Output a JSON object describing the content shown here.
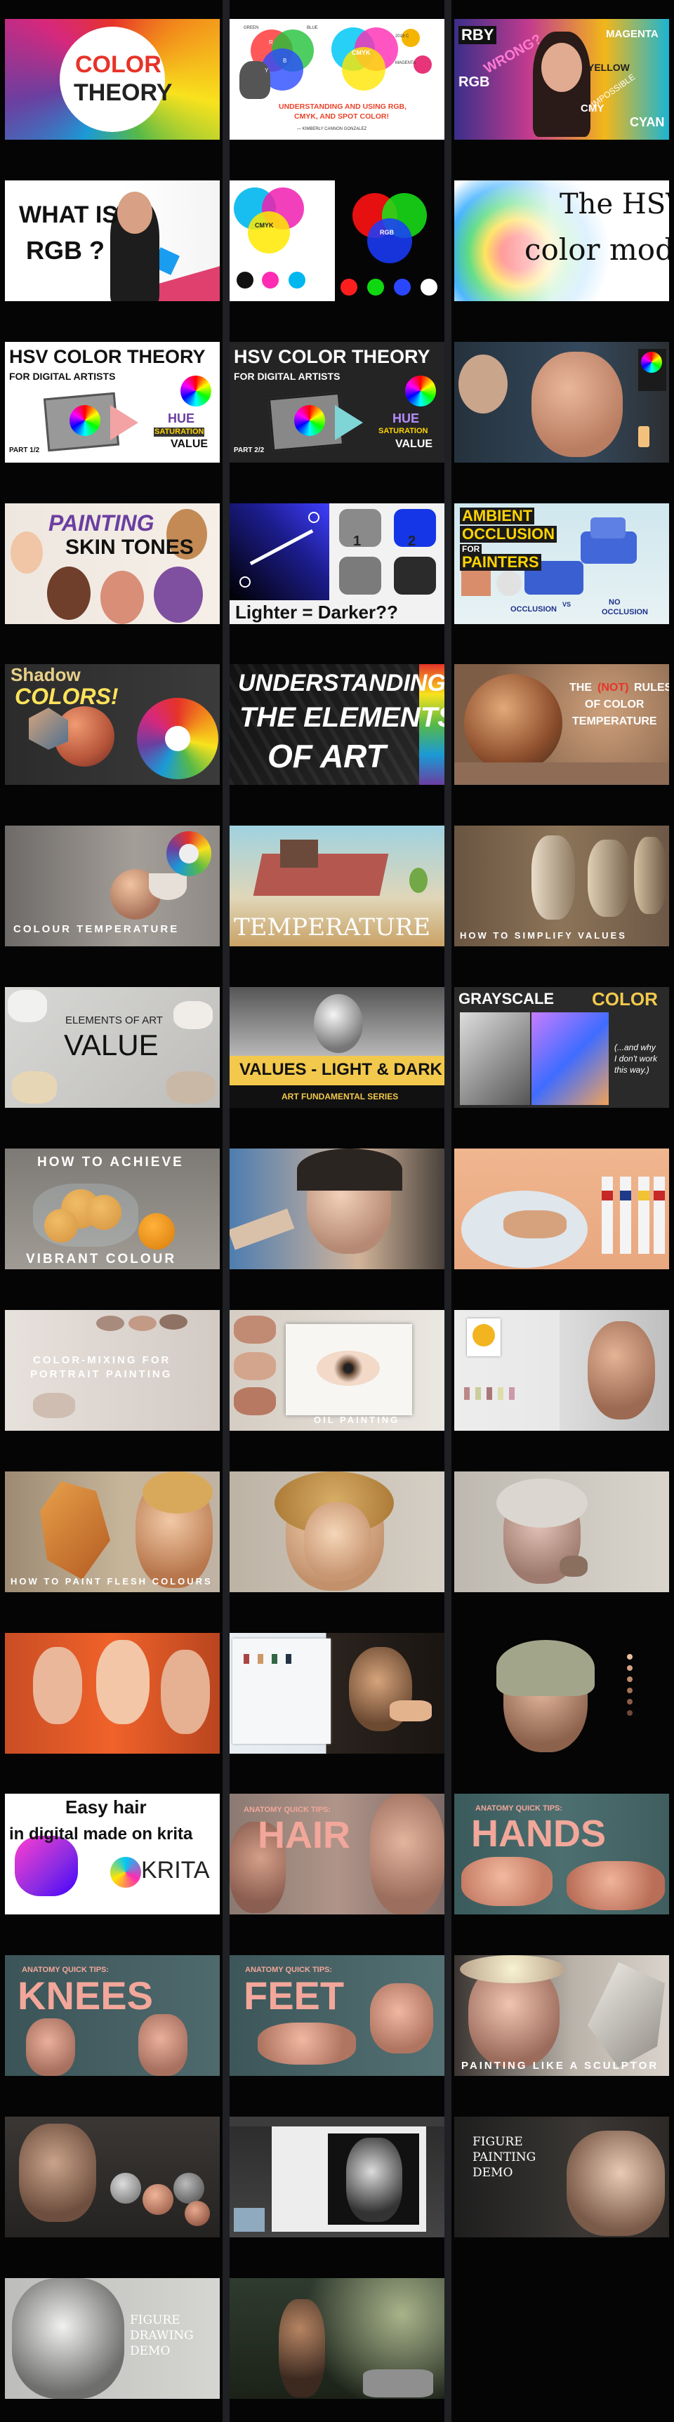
{
  "videos": [
    {
      "id": "v1",
      "lines": [
        "COLOR",
        "THEORY"
      ]
    },
    {
      "id": "v2",
      "lines": [
        "UNDERSTANDING AND USING RGB,",
        "CMYK, AND SPOT COLOR!",
        "— KIMBERLY CANNON GONZALEZ",
        "R",
        "Y",
        "B",
        "CMYK",
        "2019 C",
        "MAGENTA",
        "GREEN",
        "BLUE"
      ]
    },
    {
      "id": "v3",
      "lines": [
        "RBY",
        "RGB",
        "WRONG?",
        "YELLOW",
        "MAGENTA",
        "CYAN",
        "CMY",
        "IMPOSSIBLE"
      ]
    },
    {
      "id": "v4",
      "lines": [
        "WHAT IS",
        "RGB ?"
      ]
    },
    {
      "id": "v5",
      "lines": [
        "CMYK",
        "RGB"
      ]
    },
    {
      "id": "v6",
      "lines": [
        "The HSV",
        "color model"
      ]
    },
    {
      "id": "v7",
      "lines": [
        "HSV COLOR THEORY",
        "FOR DIGITAL ARTISTS",
        "PART 1/2",
        "HUE",
        "SATURATION",
        "VALUE"
      ]
    },
    {
      "id": "v8",
      "lines": [
        "HSV COLOR THEORY",
        "FOR DIGITAL ARTISTS",
        "PART 2/2",
        "HUE",
        "SATURATION",
        "VALUE"
      ]
    },
    {
      "id": "v9",
      "lines": []
    },
    {
      "id": "v10",
      "lines": [
        "PAINTING",
        "SKIN TONES"
      ]
    },
    {
      "id": "v11",
      "lines": [
        "1",
        "2",
        "Lighter = Darker??"
      ]
    },
    {
      "id": "v12",
      "lines": [
        "AMBIENT",
        "OCCLUSION",
        "FOR",
        "PAINTERS",
        "OCCLUSION",
        "VS",
        "NO",
        "OCCLUSION"
      ]
    },
    {
      "id": "v13",
      "lines": [
        "Shadow",
        "COLORS!"
      ]
    },
    {
      "id": "v14",
      "lines": [
        "UNDERSTANDING",
        "THE ELEMENTS",
        "OF ART"
      ]
    },
    {
      "id": "v15",
      "lines": [
        "THE",
        "(NOT)",
        "RULES",
        "OF COLOR",
        "TEMPERATURE"
      ]
    },
    {
      "id": "v16",
      "lines": [
        "COLOUR TEMPERATURE"
      ]
    },
    {
      "id": "v17",
      "lines": [
        "TEMPERATURE"
      ]
    },
    {
      "id": "v18",
      "lines": [
        "HOW TO SIMPLIFY VALUES"
      ]
    },
    {
      "id": "v19",
      "lines": [
        "ELEMENTS OF ART",
        "VALUE"
      ]
    },
    {
      "id": "v20",
      "lines": [
        "VALUES - LIGHT & DARK",
        "ART FUNDAMENTAL SERIES"
      ]
    },
    {
      "id": "v21",
      "lines": [
        "GRAYSCALE",
        "COLOR",
        "(...and why",
        "I don't work",
        "this way.)"
      ]
    },
    {
      "id": "v22",
      "lines": [
        "HOW TO ACHIEVE",
        "VIBRANT COLOUR"
      ]
    },
    {
      "id": "v23",
      "lines": []
    },
    {
      "id": "v24",
      "lines": []
    },
    {
      "id": "v25",
      "lines": [
        "COLOR-MIXING FOR",
        "PORTRAIT PAINTING"
      ]
    },
    {
      "id": "v26",
      "lines": [
        "OIL PAINTING"
      ]
    },
    {
      "id": "v27",
      "lines": []
    },
    {
      "id": "v28",
      "lines": [
        "HOW TO PAINT FLESH COLOURS"
      ]
    },
    {
      "id": "v29",
      "lines": []
    },
    {
      "id": "v30",
      "lines": []
    },
    {
      "id": "v31",
      "lines": []
    },
    {
      "id": "v32",
      "lines": []
    },
    {
      "id": "v33",
      "lines": []
    },
    {
      "id": "v34",
      "lines": [
        "Easy hair",
        "in digital made on krita",
        "KRITA"
      ]
    },
    {
      "id": "v35",
      "lines": [
        "ANATOMY QUICK TIPS:",
        "HAIR"
      ]
    },
    {
      "id": "v36",
      "lines": [
        "ANATOMY QUICK TIPS:",
        "HANDS"
      ]
    },
    {
      "id": "v37",
      "lines": [
        "ANATOMY QUICK TIPS:",
        "KNEES"
      ]
    },
    {
      "id": "v38",
      "lines": [
        "ANATOMY QUICK TIPS:",
        "FEET"
      ]
    },
    {
      "id": "v39",
      "lines": [
        "PAINTING LIKE A SCULPTOR"
      ]
    },
    {
      "id": "v40",
      "lines": []
    },
    {
      "id": "v41",
      "lines": []
    },
    {
      "id": "v42",
      "lines": [
        "FIGURE",
        "PAINTING",
        "DEMO"
      ]
    },
    {
      "id": "v43",
      "lines": [
        "FIGURE",
        "DRAWING",
        "DEMO"
      ]
    },
    {
      "id": "v44",
      "lines": []
    }
  ],
  "colors": {
    "page_background": "#1f2125",
    "column_background": "#050505",
    "accent_yellow": "#f6d90f",
    "accent_orange": "#e45a1f",
    "accent_pink": "#f2a79a"
  }
}
